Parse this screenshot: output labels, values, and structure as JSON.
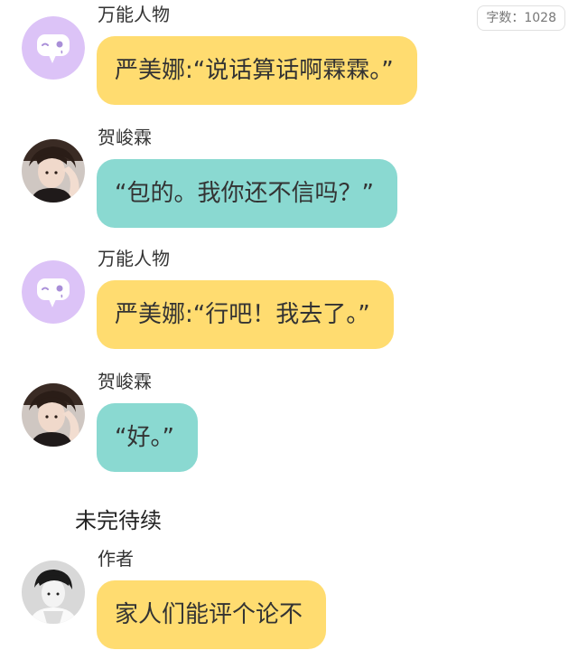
{
  "word_count": "字数：1028",
  "messages": [
    {
      "name": "万能人物",
      "text": "严美娜:“说话算话啊霖霖。”"
    },
    {
      "name": "贺峻霖",
      "text": "“包的。我你还不信吗？”"
    },
    {
      "name": "万能人物",
      "text": "严美娜:“行吧！我去了。”"
    },
    {
      "name": "贺峻霖",
      "text": "“好。”"
    },
    {
      "name": "作者",
      "text": "家人们能评个论不"
    }
  ],
  "end_text": "未完待续",
  "colors": {
    "narrator_bubble": "#ffdc70",
    "character_bubble": "#8ad9d1",
    "narrator_avatar": "#dcc3f7"
  },
  "icons": {
    "narrator_avatar": "chat-bubble-wink-icon",
    "character_avatar": "user-photo",
    "author_avatar": "user-photo"
  }
}
